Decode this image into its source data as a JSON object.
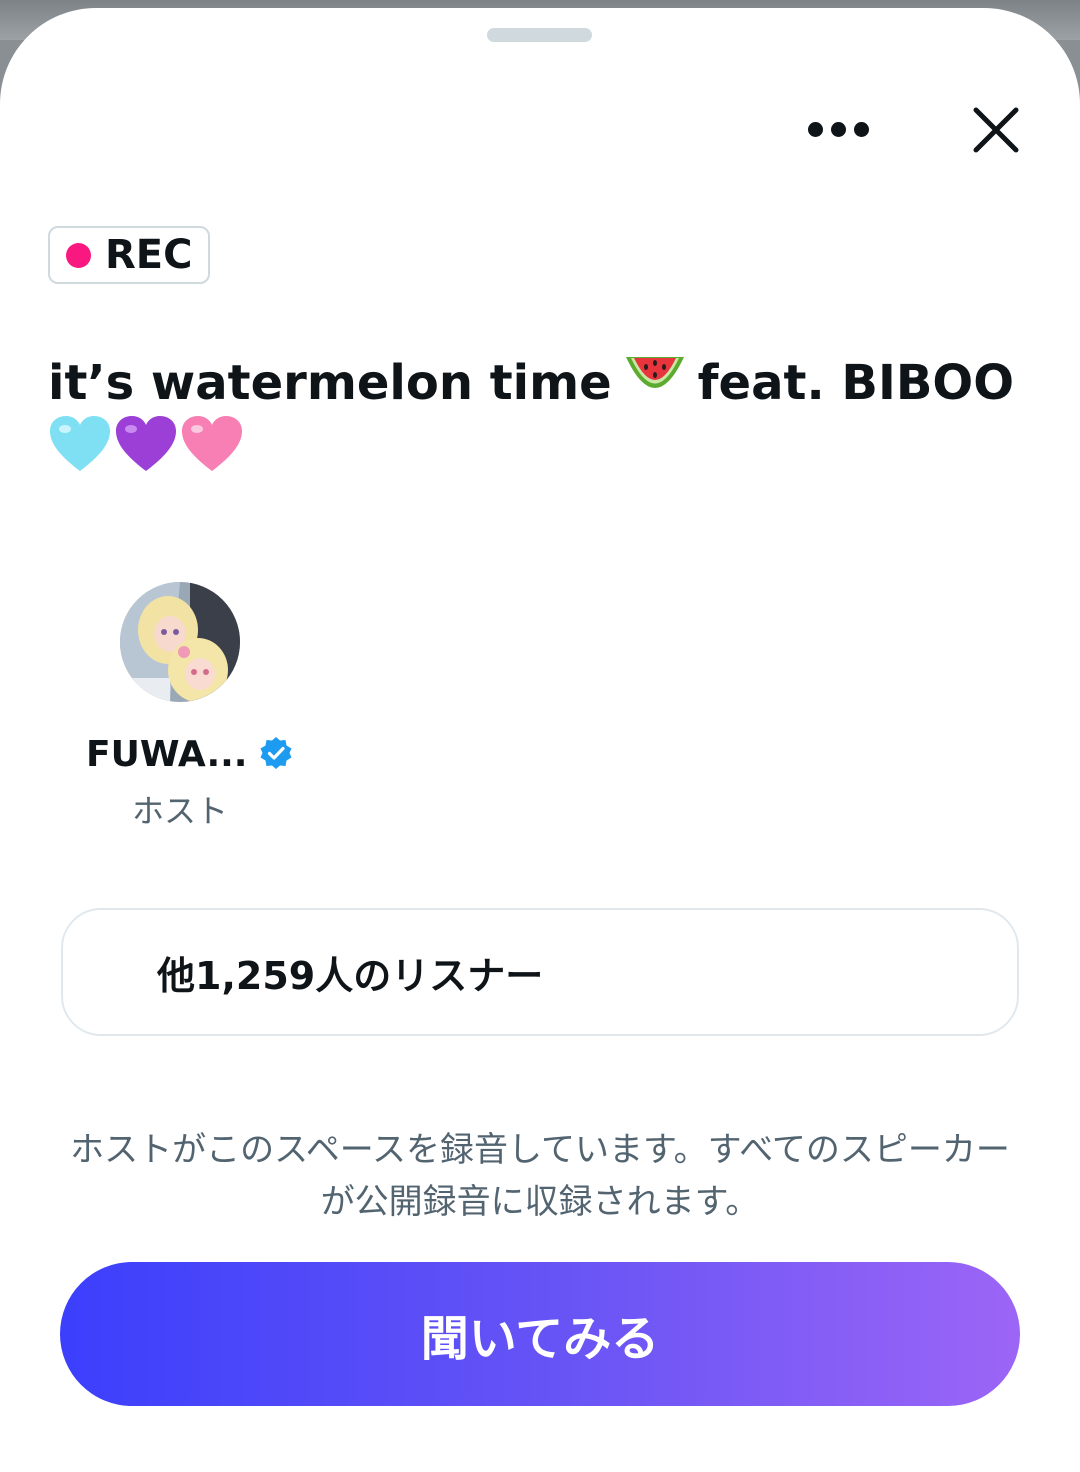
{
  "rec_badge": {
    "label": "REC"
  },
  "space": {
    "title_text": "it’s watermelon time",
    "title_emoji": "watermelon",
    "title_after": "feat. BIBOO",
    "title_hearts": [
      "light-blue-heart",
      "purple-heart",
      "pink-heart"
    ]
  },
  "host": {
    "name": "FUWA...",
    "role": "ホスト",
    "verified": true
  },
  "listeners": {
    "label": "他1,259人のリスナー"
  },
  "recording_note": "ホストがこのスペースを録音しています。すべてのスピーカーが公開録音に収録されます。",
  "cta": {
    "label": "聞いてみる"
  },
  "icons": {
    "more": "more-horizontal-icon",
    "close": "close-icon",
    "verified": "verified-badge-icon"
  },
  "colors": {
    "rec_dot": "#f91880",
    "verified": "#1d9bf0",
    "cta_gradient_start": "#3b3ffc",
    "cta_gradient_end": "#9c65f6",
    "secondary_text": "#536471"
  }
}
